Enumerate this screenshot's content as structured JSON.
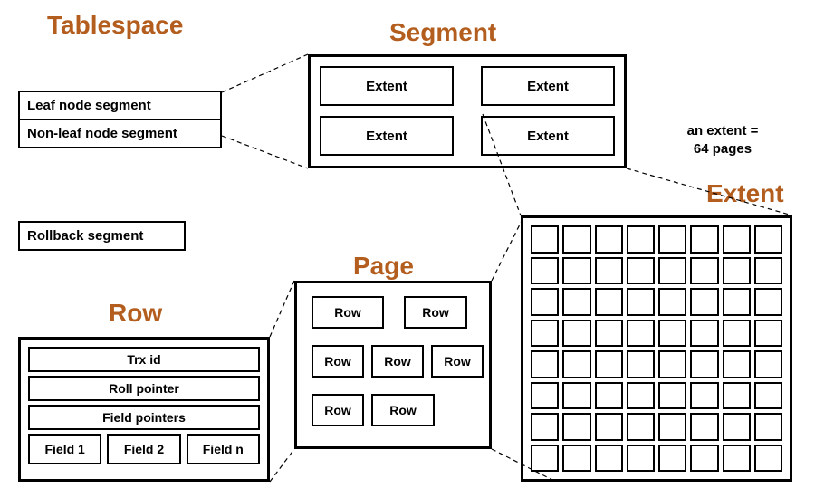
{
  "titles": {
    "tablespace": "Tablespace",
    "segment": "Segment",
    "page": "Page",
    "row": "Row",
    "extent": "Extent"
  },
  "tablespace": {
    "segments": [
      "Leaf node segment",
      "Non-leaf node segment"
    ],
    "rollback": "Rollback segment"
  },
  "segment": {
    "extents": [
      "Extent",
      "Extent",
      "Extent",
      "Extent"
    ]
  },
  "note": {
    "line1": "an extent =",
    "line2": "64 pages"
  },
  "extent": {
    "grid_cols": 8,
    "grid_rows": 8,
    "total_pages": 64
  },
  "page": {
    "rows": [
      "Row",
      "Row",
      "Row",
      "Row",
      "Row",
      "Row",
      "Row"
    ]
  },
  "row": {
    "header": [
      "Trx id",
      "Roll pointer",
      "Field pointers"
    ],
    "fields": [
      "Field 1",
      "Field 2",
      "Field n"
    ]
  }
}
